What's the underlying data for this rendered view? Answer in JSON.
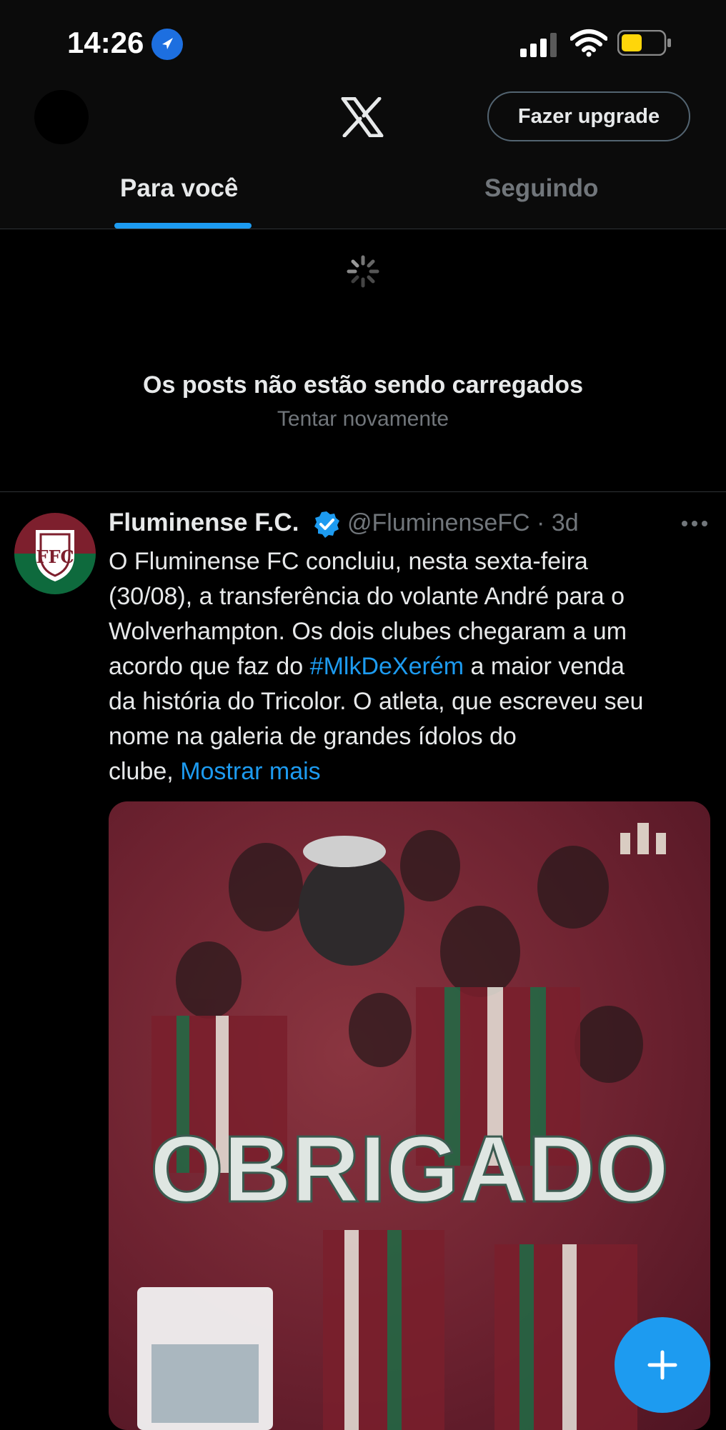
{
  "status_bar": {
    "time": "14:26"
  },
  "header": {
    "upgrade_label": "Fazer upgrade"
  },
  "tabs": [
    {
      "label": "Para você",
      "active": true
    },
    {
      "label": "Seguindo",
      "active": false
    }
  ],
  "feed_error": {
    "title": "Os posts não estão sendo carregados",
    "retry_label": "Tentar novamente"
  },
  "tweet": {
    "author_name": "Fluminense F.C.",
    "handle": "@FluminenseFC",
    "separator": " · ",
    "age": "3d",
    "text_part1": "O Fluminense FC concluiu, nesta sexta-feira\n(30/08), a transferência do volante André para o\nWolverhampton. Os dois clubes chegaram a um\nacordo que faz do ",
    "hashtag": "#MlkDeXerém",
    "text_part2": " a maior venda\nda história do Tricolor. O atleta, que escreveu seu\nnome na galeria de grandes ídolos do\nclube, ",
    "show_more": "Mostrar mais",
    "media_caption": "OBRIGADO"
  },
  "colors": {
    "accent": "#1d9bf0",
    "muted": "#71767b",
    "text": "#e7e9ea",
    "background": "#000000"
  }
}
